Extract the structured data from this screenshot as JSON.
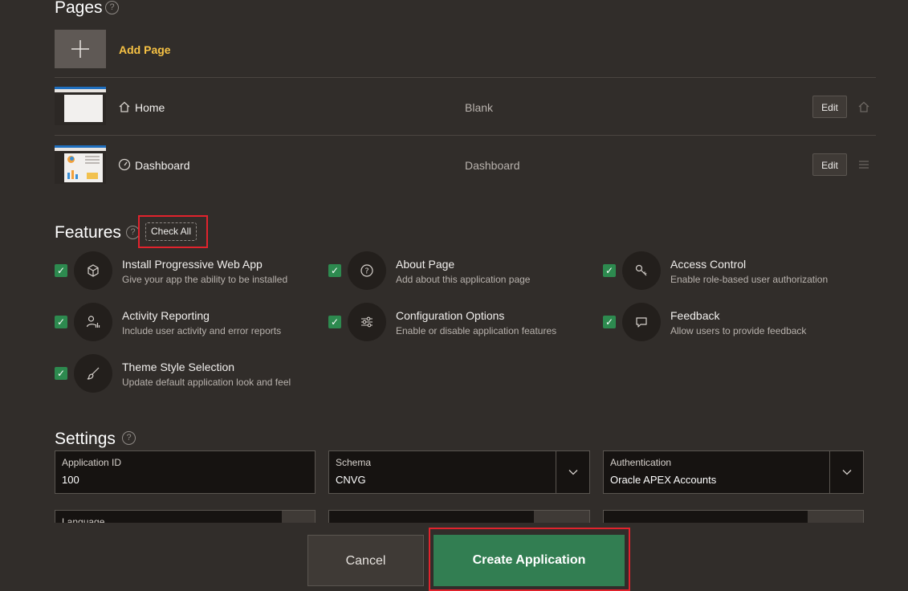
{
  "pages": {
    "title": "Pages",
    "add_label": "Add Page",
    "list": [
      {
        "name": "Home",
        "type": "Blank",
        "edit_label": "Edit",
        "icon": "home-icon",
        "action_icon": "home-icon"
      },
      {
        "name": "Dashboard",
        "type": "Dashboard",
        "edit_label": "Edit",
        "icon": "gauge-icon",
        "action_icon": "drag-handle-icon"
      }
    ]
  },
  "features": {
    "title": "Features",
    "check_all_label": "Check All",
    "items": [
      {
        "title": "Install Progressive Web App",
        "desc": "Give your app the ability to be installed",
        "checked": true,
        "icon": "cube-icon"
      },
      {
        "title": "About Page",
        "desc": "Add about this application page",
        "checked": true,
        "icon": "question-icon"
      },
      {
        "title": "Access Control",
        "desc": "Enable role-based user authorization",
        "checked": true,
        "icon": "key-icon"
      },
      {
        "title": "Activity Reporting",
        "desc": "Include user activity and error reports",
        "checked": true,
        "icon": "user-chart-icon"
      },
      {
        "title": "Configuration Options",
        "desc": "Enable or disable application features",
        "checked": true,
        "icon": "sliders-icon"
      },
      {
        "title": "Feedback",
        "desc": "Allow users to provide feedback",
        "checked": true,
        "icon": "comment-icon"
      },
      {
        "title": "Theme Style Selection",
        "desc": "Update default application look and feel",
        "checked": true,
        "icon": "brush-icon"
      }
    ]
  },
  "settings": {
    "title": "Settings",
    "application_id": {
      "label": "Application ID",
      "value": "100"
    },
    "schema": {
      "label": "Schema",
      "value": "CNVG"
    },
    "authentication": {
      "label": "Authentication",
      "value": "Oracle APEX Accounts"
    },
    "language": {
      "label": "Language"
    }
  },
  "footer": {
    "cancel_label": "Cancel",
    "create_label": "Create Application"
  },
  "colors": {
    "background": "#312d2a",
    "accent_yellow": "#f7c244",
    "checkbox_green": "#2d8a4f",
    "create_green": "#327e52",
    "highlight_red": "#e1232d"
  }
}
